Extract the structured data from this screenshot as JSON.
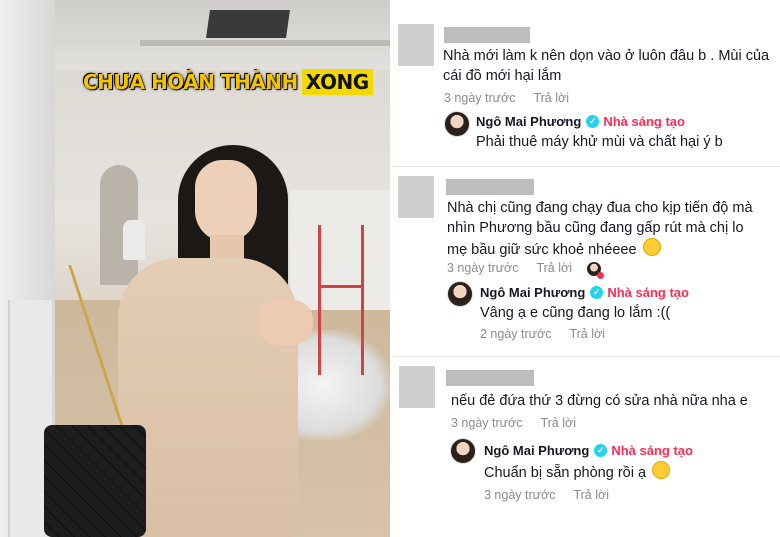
{
  "video": {
    "caption_yellow": "CHƯA HOÀN THÀNH",
    "caption_highlight": "XONG"
  },
  "comments": [
    {
      "text": "Nhà mới làm k nên dọn vào ở luôn đâu b . Mùi của cái đồ mới hại lắm",
      "time": "3 ngày trước",
      "reply_label": "Trả lời",
      "reply": {
        "name": "Ngô Mai Phương",
        "badge": "Nhà sáng tạo",
        "text": "Phải thuê máy khử mùi và chất hại ý b",
        "time": "",
        "reply_label": ""
      }
    },
    {
      "text": "Nhà chị cũng đang chạy đua cho kịp tiến độ mà nhìn Phương bầu cũng đang gấp rút mà chị lo mẹ bầu giữ sức khoẻ nhéeee",
      "time": "3 ngày trước",
      "reply_label": "Trả lời",
      "reply": {
        "name": "Ngô Mai Phương",
        "badge": "Nhà sáng tạo",
        "text": "Vâng ạ e cũng đang lo lắm :((",
        "time": "2 ngày trước",
        "reply_label": "Trả lời"
      }
    },
    {
      "text": "nếu đẻ đứa thứ 3 đừng có sửa nhà nữa nha e",
      "time": "3 ngày trước",
      "reply_label": "Trả lời",
      "reply": {
        "name": "Ngô Mai Phương",
        "badge": "Nhà sáng tạo",
        "text": "Chuẩn bị sẵn phòng rồi ạ",
        "time": "3 ngày trước",
        "reply_label": "Trả lời"
      }
    }
  ],
  "colors": {
    "creator_badge": "#fe2c55",
    "verified": "#20d5ec",
    "caption_yellow": "#f5c400"
  }
}
